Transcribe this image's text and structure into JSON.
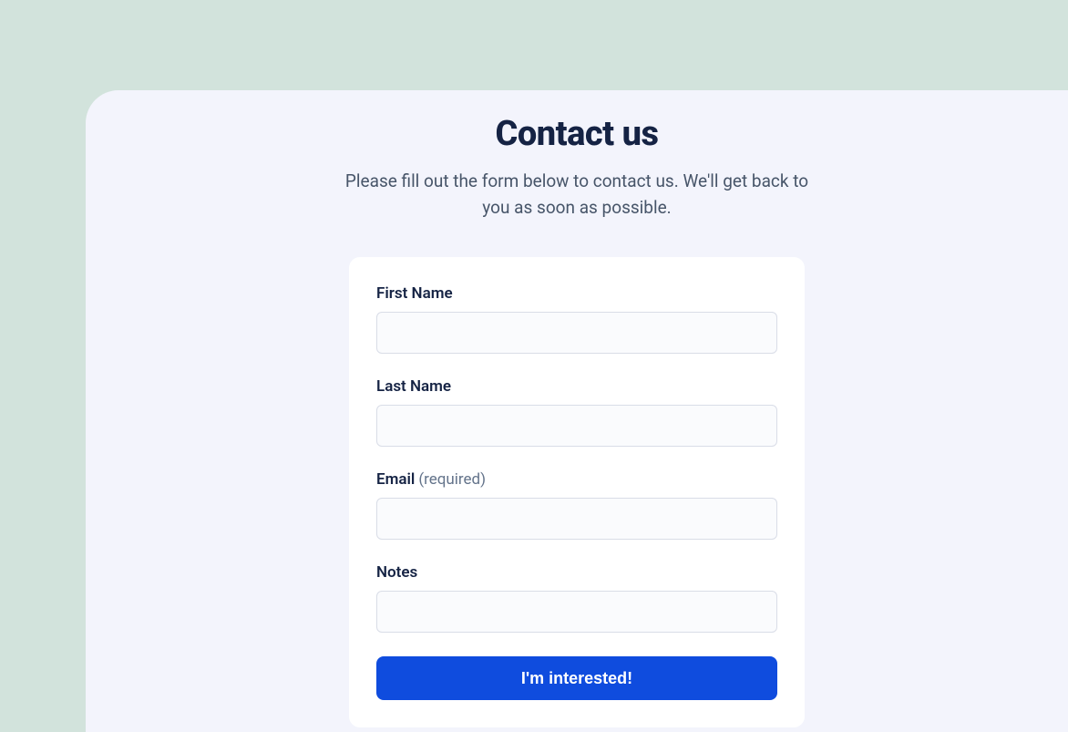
{
  "header": {
    "title": "Contact us",
    "description": "Please fill out the form below to contact us. We'll get back to you as soon as possible."
  },
  "form": {
    "fields": {
      "first_name": {
        "label": "First Name",
        "value": ""
      },
      "last_name": {
        "label": "Last Name",
        "value": ""
      },
      "email": {
        "label": "Email",
        "required_hint": "(required)",
        "value": ""
      },
      "notes": {
        "label": "Notes",
        "value": ""
      }
    },
    "submit_label": "I'm interested!"
  }
}
